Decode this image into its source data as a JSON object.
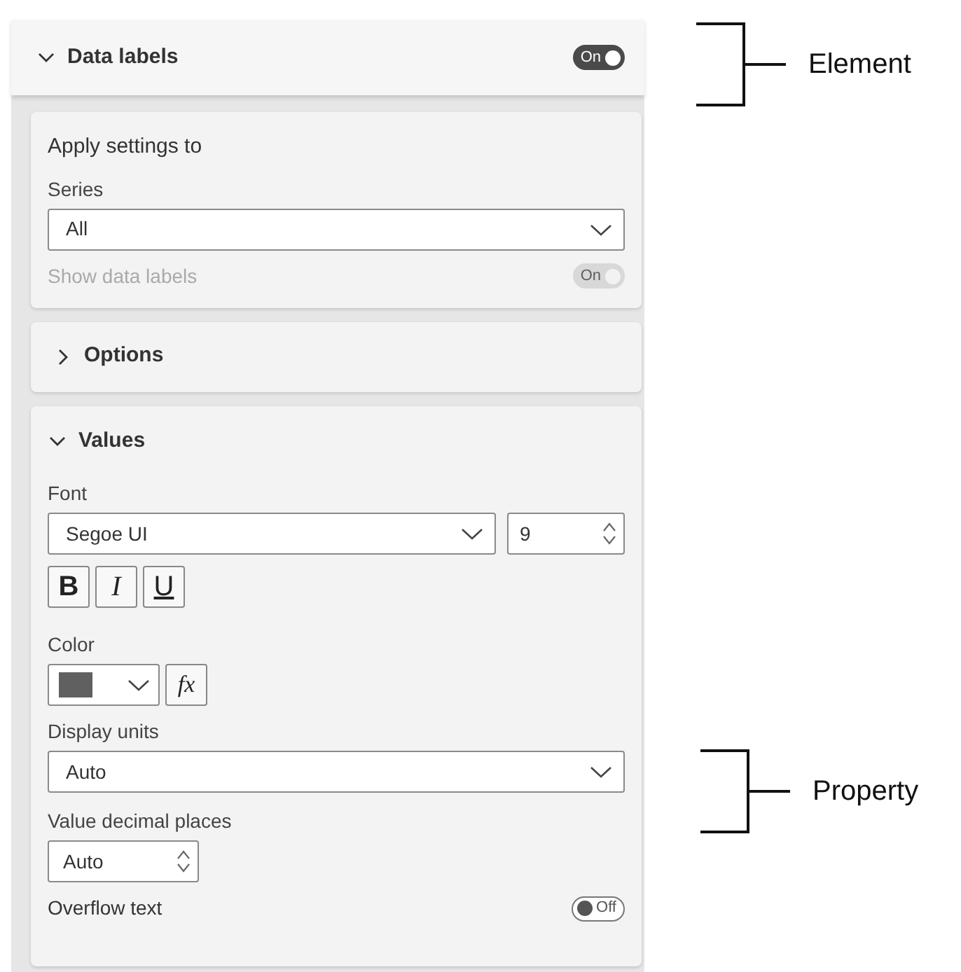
{
  "element_header": {
    "title": "Data labels",
    "expanded": true,
    "toggle": {
      "label": "On",
      "on": true
    }
  },
  "apply_settings": {
    "title": "Apply settings to",
    "series_label": "Series",
    "series_value": "All",
    "show_data_labels": {
      "label": "Show data labels",
      "toggle_label": "On",
      "on": true,
      "disabled": true
    }
  },
  "options": {
    "title": "Options",
    "expanded": false
  },
  "values": {
    "title": "Values",
    "expanded": true,
    "font_label": "Font",
    "font_value": "Segoe UI",
    "size_value": "9",
    "style_buttons": [
      {
        "label": "B",
        "kind": "bold"
      },
      {
        "label": "I",
        "kind": "italic"
      },
      {
        "label": "U",
        "kind": "underline"
      }
    ],
    "color_label": "Color",
    "color_picker": {
      "color": "#606060"
    },
    "fx_label": "fx",
    "display_units_label": "Display units",
    "display_units_value": "Auto",
    "decimal_label": "Value decimal places",
    "decimal_value": "Auto",
    "overflow": {
      "label": "Overflow text",
      "toggle_label": "Off",
      "on": false
    }
  },
  "annotations": [
    {
      "label": "Element"
    },
    {
      "label": "Property"
    }
  ]
}
